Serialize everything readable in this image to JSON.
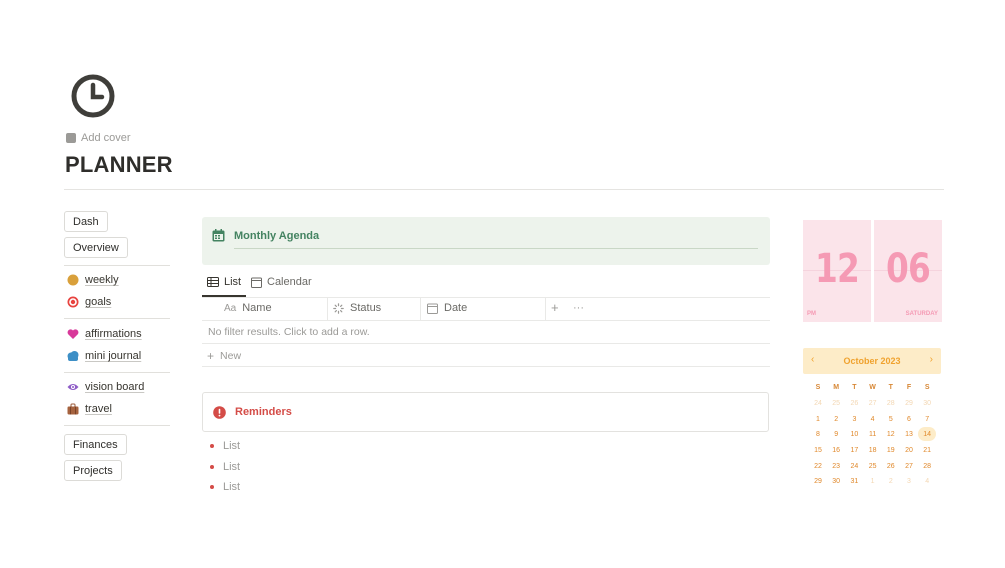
{
  "page": {
    "icon": "clock-icon",
    "add_cover": "Add cover",
    "title": "PLANNER"
  },
  "sidebar": {
    "buttons_top": [
      "Dash",
      "Overview"
    ],
    "group1": [
      {
        "label": "weekly",
        "icon": "orange-circle-icon"
      },
      {
        "label": "goals",
        "icon": "target-icon"
      }
    ],
    "group2": [
      {
        "label": "affirmations",
        "icon": "heart-icon"
      },
      {
        "label": "mini journal",
        "icon": "cloud-icon"
      }
    ],
    "group3": [
      {
        "label": "vision board",
        "icon": "eye-icon"
      },
      {
        "label": "travel",
        "icon": "suitcase-icon"
      }
    ],
    "buttons_bottom": [
      "Finances",
      "Projects"
    ]
  },
  "agenda": {
    "title": "Monthly Agenda",
    "icon": "calendar-icon",
    "tabs": [
      "List",
      "Calendar"
    ],
    "columns": [
      {
        "label": "Name",
        "icon": "text-icon",
        "icon_text": "Aa"
      },
      {
        "label": "Status",
        "icon": "status-icon"
      },
      {
        "label": "Date",
        "icon": "calendar-icon"
      }
    ],
    "add_symbol": "+",
    "more_symbol": "···",
    "empty_text": "No filter results. Click to add a row.",
    "new_label": "New"
  },
  "reminders": {
    "title": "Reminders",
    "icon": "alert-icon",
    "items": [
      "List",
      "List",
      "List"
    ]
  },
  "clock": {
    "hour": "12",
    "minute": "06",
    "period": "PM",
    "day": "SATURDAY"
  },
  "calendar": {
    "month_label": "October 2023",
    "prev_symbol": "‹",
    "next_symbol": "›",
    "weekdays": [
      "S",
      "M",
      "T",
      "W",
      "T",
      "F",
      "S"
    ],
    "weeks": [
      [
        "24",
        "25",
        "26",
        "27",
        "28",
        "29",
        "30"
      ],
      [
        "1",
        "2",
        "3",
        "4",
        "5",
        "6",
        "7"
      ],
      [
        "8",
        "9",
        "10",
        "11",
        "12",
        "13",
        "14"
      ],
      [
        "15",
        "16",
        "17",
        "18",
        "19",
        "20",
        "21"
      ],
      [
        "22",
        "23",
        "24",
        "25",
        "26",
        "27",
        "28"
      ],
      [
        "29",
        "30",
        "31",
        "1",
        "2",
        "3",
        "4"
      ]
    ],
    "muted": [
      [
        0,
        0
      ],
      [
        0,
        1
      ],
      [
        0,
        2
      ],
      [
        0,
        3
      ],
      [
        0,
        4
      ],
      [
        0,
        5
      ],
      [
        0,
        6
      ],
      [
        5,
        3
      ],
      [
        5,
        4
      ],
      [
        5,
        5
      ],
      [
        5,
        6
      ]
    ],
    "today": [
      2,
      6
    ]
  },
  "colors": {
    "agenda_bg": "#edf3ec",
    "agenda_text": "#448361",
    "reminder_red": "#d44c47",
    "clock_bg": "#fbe4ea",
    "clock_text": "#f59ab4",
    "calendar_bg": "#fdecc8",
    "calendar_text": "#f0a22e"
  }
}
